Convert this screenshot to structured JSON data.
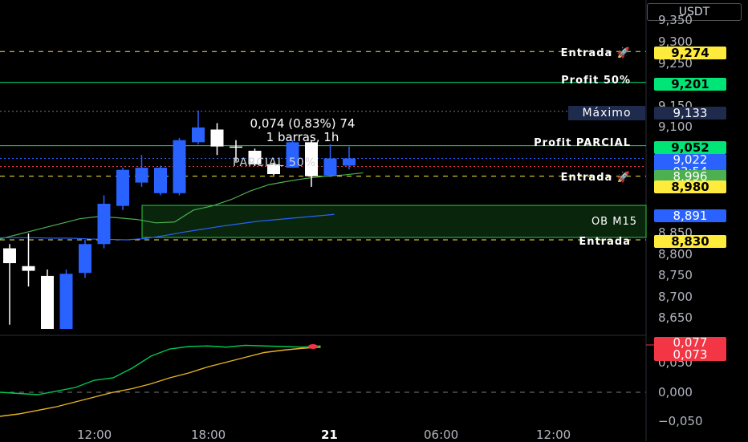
{
  "currency": "USDT",
  "price_axis": [
    "9,350",
    "9,300",
    "9,250",
    "9,150",
    "9,100",
    "8,850",
    "8,800",
    "8,750",
    "8,700",
    "8,650"
  ],
  "osc_axis": [
    "0,050",
    "0,000",
    "−0,050"
  ],
  "time_axis": [
    "12:00",
    "18:00",
    "21",
    "06:00",
    "12:00"
  ],
  "levels": {
    "entrada_top": {
      "label": "Entrada 🚀",
      "value": "9,274",
      "color": "#ffeb3b"
    },
    "profit50": {
      "label": "Profit 50%",
      "value": "9,201",
      "color": "#00e676"
    },
    "maximo": {
      "label": "Máximo",
      "value": "9,133",
      "color": "#1e2b4d"
    },
    "profit_parcial": {
      "label": "Profit PARCIAL",
      "value": "9,052",
      "color": "#00e676"
    },
    "current": {
      "value": "9,022",
      "countdown": "03:54",
      "color": "#2962ff"
    },
    "ma_value": {
      "value": "8,996",
      "color": "#4caf50"
    },
    "entrada_mid": {
      "label": "Entrada 🚀",
      "value": "8,980",
      "color": "#ffeb3b"
    },
    "ob": {
      "label": "OB M15",
      "value": "8,891",
      "color": "#2962ff"
    },
    "entrada_low": {
      "label": "Entrada",
      "value": "8,830",
      "color": "#ffeb3b"
    }
  },
  "osc_tags": {
    "a": "0,077",
    "b": "0,073",
    "color": "#f23645"
  },
  "measure": {
    "line1": "0,074 (0,83%) 74",
    "line2": "1 barras, 1h"
  },
  "parcial_label": "PARCIAL 50%",
  "candles": [
    {
      "o": 8810,
      "c": 8775,
      "h": 8820,
      "l": 8630
    },
    {
      "o": 8768,
      "c": 8757,
      "h": 8845,
      "l": 8720
    },
    {
      "o": 8745,
      "c": 8620,
      "h": 8760,
      "l": 8620
    },
    {
      "o": 8620,
      "c": 8750,
      "h": 8760,
      "l": 8620
    },
    {
      "o": 8752,
      "c": 8820,
      "h": 8830,
      "l": 8740
    },
    {
      "o": 8820,
      "c": 8915,
      "h": 8935,
      "l": 8810
    },
    {
      "o": 8910,
      "c": 8995,
      "h": 9000,
      "l": 8900
    },
    {
      "o": 8965,
      "c": 9000,
      "h": 9030,
      "l": 8955
    },
    {
      "o": 8940,
      "c": 9000,
      "h": 9005,
      "l": 8935
    },
    {
      "o": 8940,
      "c": 9065,
      "h": 9070,
      "l": 8935
    },
    {
      "o": 9060,
      "c": 9095,
      "h": 9135,
      "l": 9055
    },
    {
      "o": 9090,
      "c": 9050,
      "h": 9105,
      "l": 9030
    },
    {
      "o": 9050,
      "c": 9048,
      "h": 9065,
      "l": 9015
    },
    {
      "o": 9040,
      "c": 9008,
      "h": 9045,
      "l": 9005
    },
    {
      "o": 9008,
      "c": 8985,
      "h": 9012,
      "l": 8982
    },
    {
      "o": 9000,
      "c": 9060,
      "h": 9065,
      "l": 9000
    },
    {
      "o": 9060,
      "c": 8980,
      "h": 9065,
      "l": 8955
    },
    {
      "o": 8982,
      "c": 9022,
      "h": 9055,
      "l": 8978
    },
    {
      "o": 9005,
      "c": 9022,
      "h": 9050,
      "l": 8996
    }
  ],
  "ma_green": [
    8880,
    8885,
    8882,
    8878,
    8870,
    8872,
    8900,
    8910,
    8925,
    8945,
    8960,
    8968,
    8975,
    8980,
    8983,
    8988
  ],
  "ma_blue": [
    8835,
    8835,
    8834,
    8834,
    8832,
    8831,
    8830,
    8833,
    8840,
    8848,
    8855,
    8862,
    8868,
    8874,
    8878,
    8882,
    8886,
    8890
  ],
  "osc_green": [
    0.0,
    -0.002,
    -0.004,
    0.002,
    0.008,
    0.02,
    0.024,
    0.04,
    0.06,
    0.072,
    0.076,
    0.077,
    0.075,
    0.078,
    0.077,
    0.076,
    0.075,
    0.077
  ],
  "osc_yellow": [
    -0.04,
    -0.036,
    -0.03,
    -0.024,
    -0.016,
    -0.008,
    0.0,
    0.006,
    0.014,
    0.024,
    0.032,
    0.042,
    0.05,
    0.058,
    0.066,
    0.07,
    0.073,
    0.075
  ]
}
